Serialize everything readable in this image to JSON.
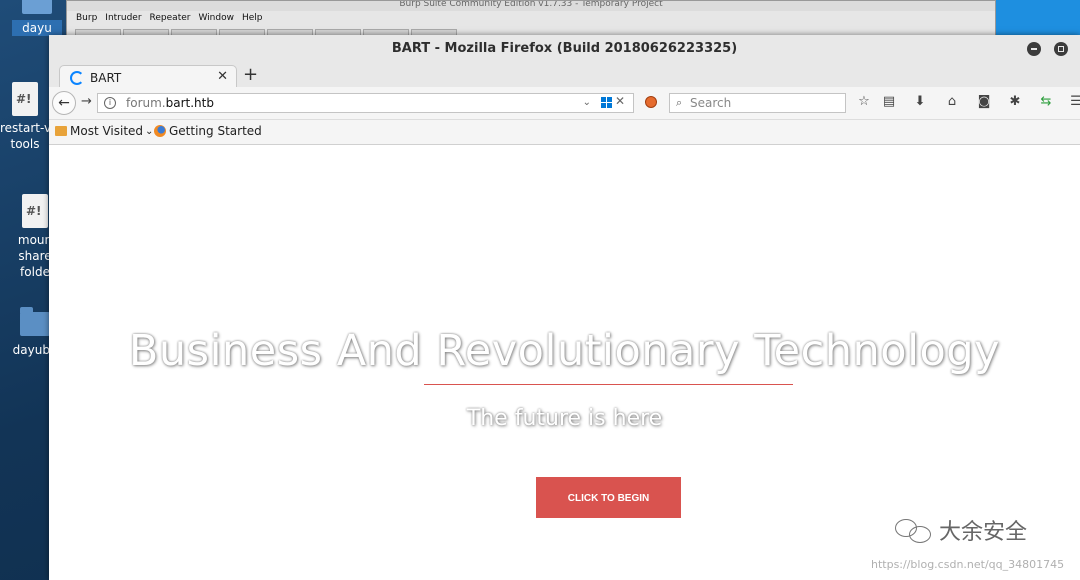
{
  "desktop": {
    "icons": [
      {
        "label": "dayu"
      },
      {
        "label": "restart-v\ntools"
      },
      {
        "label": "moun\nshare\nfolde"
      },
      {
        "label": "dayuba"
      }
    ]
  },
  "burp": {
    "title": "Burp Suite Community Edition v1.7.33 - Temporary Project",
    "menu": [
      "Burp",
      "Intruder",
      "Repeater",
      "Window",
      "Help"
    ]
  },
  "firefox": {
    "window_title": "BART - Mozilla Firefox (Build 20180626223325)",
    "tab_title": "BART",
    "url_host_prefix": "forum.",
    "url_host_main": "bart.htb",
    "search_placeholder": "Search",
    "bookmarks": {
      "most_visited": "Most Visited",
      "getting_started": "Getting Started"
    },
    "icons": {
      "back": "back-arrow-icon",
      "forward": "forward-arrow-icon",
      "star": "bookmark-star-icon",
      "library": "library-icon",
      "download": "download-icon",
      "home": "home-icon",
      "pocket": "pocket-icon",
      "menu": "hamburger-menu-icon"
    }
  },
  "page": {
    "headline": "Business And Revolutionary Technology",
    "subheadline": "The future is here",
    "cta_label": "CLICK TO BEGIN",
    "accent_color": "#d9534f"
  },
  "watermark": {
    "brand": "大余安全",
    "url": "https://blog.csdn.net/qq_34801745"
  }
}
